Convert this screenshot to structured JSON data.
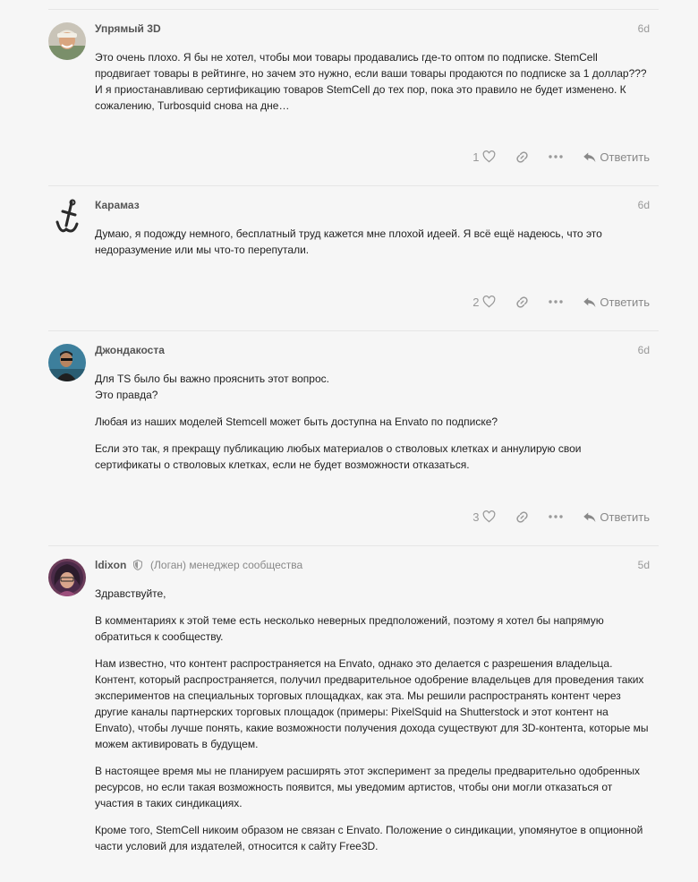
{
  "posts": [
    {
      "username": "Упрямый 3D",
      "date": "6d",
      "likes": "1",
      "reply_label": "Ответить",
      "paragraphs": [
        "Это очень плохо. Я бы не хотел, чтобы мои товары продавались где-то оптом по подписке. StemCell продвигает товары в рейтинге, но зачем это нужно, если ваши товары продаются по подписке за 1 доллар??? И я приостанавливаю сертификацию товаров StemCell до тех пор, пока это правило не будет изменено. К сожалению, Turbosquid снова на дне…"
      ]
    },
    {
      "username": "Карамаз",
      "date": "6d",
      "likes": "2",
      "reply_label": "Ответить",
      "paragraphs": [
        "Думаю, я подожду немного, бесплатный труд кажется мне плохой идеей. Я всё ещё надеюсь, что это недоразумение или мы что-то перепутали."
      ]
    },
    {
      "username": "Джондакоста",
      "date": "6d",
      "likes": "3",
      "reply_label": "Ответить",
      "line1": "Для TS было бы важно прояснить этот вопрос.",
      "line2": "Это правда?",
      "paragraphs": [
        "Любая из наших моделей Stemcell может быть доступна на Envato по подписке?",
        "Если это так, я прекращу публикацию любых материалов о стволовых клетках и аннулирую свои сертификаты о стволовых клетках, если не будет возможности отказаться."
      ]
    },
    {
      "username": "ldixon",
      "title": "(Логан) менеджер сообщества",
      "date": "5d",
      "paragraphs": [
        "Здравствуйте,",
        "В комментариях к этой теме есть несколько неверных предположений, поэтому я хотел бы напрямую обратиться к сообществу.",
        "Нам известно, что контент распространяется на Envato, однако это делается с разрешения владельца. Контент, который распространяется, получил предварительное одобрение владельцев для проведения таких экспериментов на специальных торговых площадках, как эта. Мы решили распространять контент через другие каналы партнерских торговых площадок (примеры: PixelSquid на Shutterstock и этот контент на Envato), чтобы лучше понять, какие возможности получения дохода существуют для 3D-контента, которые мы можем активировать в будущем.",
        "В настоящее время мы не планируем расширять этот эксперимент за пределы предварительно одобренных ресурсов, но если такая возможность появится, мы уведомим артистов, чтобы они могли отказаться от участия в таких синдикациях.",
        "Кроме того, StemCell никоим образом не связан с Envato. Положение о синдикации, упомянутое в опционной части условий для издателей, относится к сайту Free3D."
      ]
    }
  ],
  "colors": {
    "background": "#f6f6f6",
    "text": "#222222",
    "muted": "#999999",
    "divider": "#e6e6e6"
  },
  "icons": [
    "heart-icon",
    "link-icon",
    "more-icon",
    "reply-icon",
    "shield-icon"
  ]
}
